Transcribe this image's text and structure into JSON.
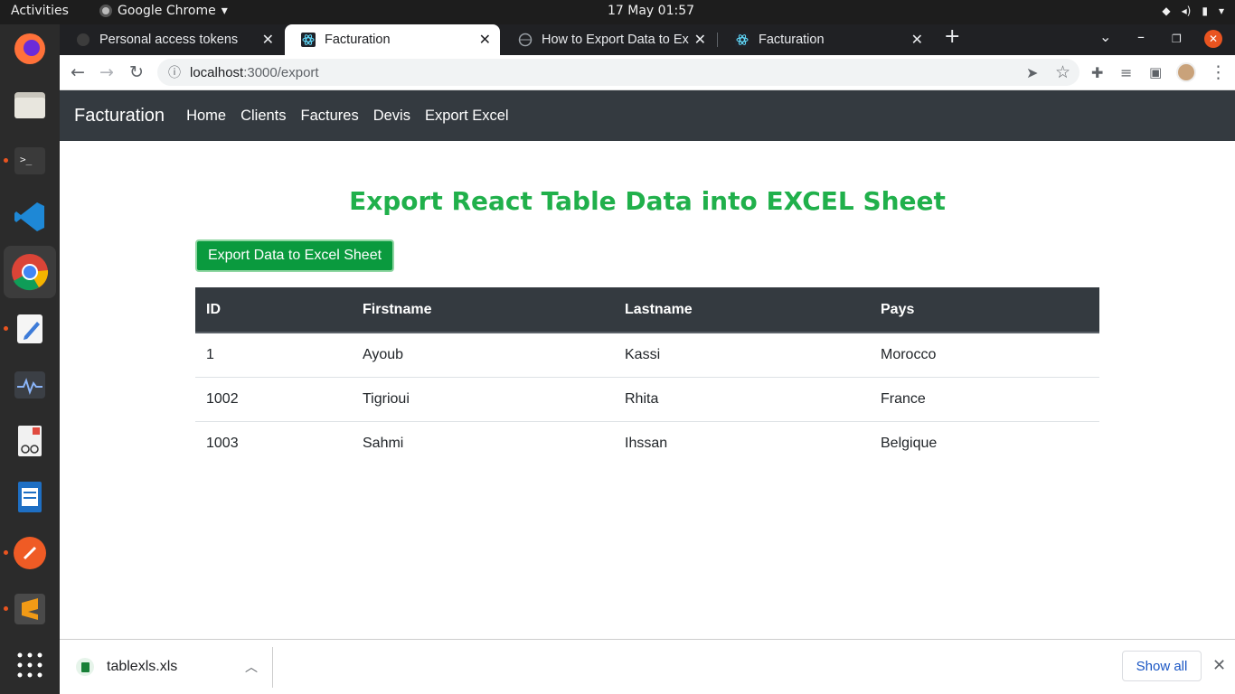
{
  "topbar": {
    "activities": "Activities",
    "app_menu": "Google Chrome",
    "clock": "17 May  01:57"
  },
  "tabs": [
    {
      "title": "Personal access tokens",
      "icon": "github-icon",
      "active": false
    },
    {
      "title": "Facturation",
      "icon": "react-icon",
      "active": true
    },
    {
      "title": "How to Export Data to Ex",
      "icon": "globe-icon",
      "active": false
    },
    {
      "title": "Facturation",
      "icon": "react-icon",
      "active": false
    }
  ],
  "address_bar": {
    "host": "localhost",
    "path": ":3000/export"
  },
  "navbar": {
    "brand": "Facturation",
    "links": [
      "Home",
      "Clients",
      "Factures",
      "Devis",
      "Export Excel"
    ]
  },
  "main": {
    "heading": "Export React Table Data into EXCEL Sheet",
    "export_button": "Export Data to Excel Sheet",
    "accent_color": "#20b04b"
  },
  "table": {
    "headers": [
      "ID",
      "Firstname",
      "Lastname",
      "Pays"
    ],
    "rows": [
      [
        "1",
        "Ayoub",
        "Kassi",
        "Morocco"
      ],
      [
        "1002",
        "Tigrioui",
        "Rhita",
        "France"
      ],
      [
        "1003",
        "Sahmi",
        "Ihssan",
        "Belgique"
      ]
    ]
  },
  "downloads": {
    "file_name": "tablexls.xls",
    "show_all": "Show all"
  }
}
